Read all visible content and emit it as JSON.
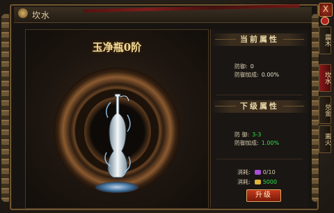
{
  "window": {
    "title": "坎水"
  },
  "item": {
    "name": "玉净瓶0阶"
  },
  "current": {
    "header": "当前属性",
    "defense_label": "防御:",
    "defense_value": "0",
    "defense_bonus_label": "防御加成:",
    "defense_bonus_value": "0.00%"
  },
  "next": {
    "header": "下级属性",
    "defense_label": "防 御:",
    "defense_value": "3-3",
    "defense_bonus_label": "防御加成:",
    "defense_bonus_value": "1.00%"
  },
  "cost": {
    "label": "消耗:",
    "material_value": "0/10",
    "gold_value": "5000"
  },
  "buttons": {
    "upgrade": "升级",
    "close": "X"
  },
  "tabs": [
    {
      "label": "震木",
      "active": false
    },
    {
      "label": "坎水",
      "active": true
    },
    {
      "label": "兑金",
      "active": false
    },
    {
      "label": "离火",
      "active": false
    }
  ],
  "colors": {
    "accent_green": "#33e04a",
    "title_gold": "#f2dc9a",
    "frame_bronze": "#6e5431"
  },
  "icons": {
    "material": "purple-gem-icon",
    "gold": "gold-ingot-icon"
  }
}
